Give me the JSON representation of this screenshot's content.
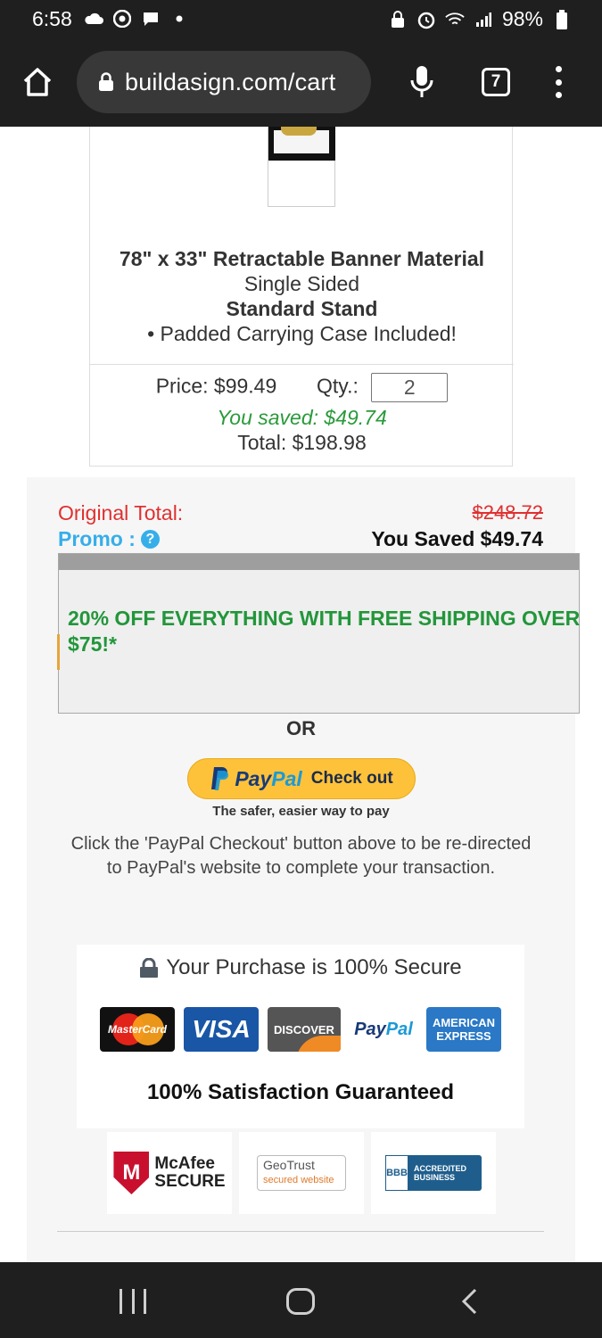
{
  "status_bar": {
    "time": "6:58",
    "battery": "98%"
  },
  "browser": {
    "url": "buildasign.com/cart",
    "tab_count": "7"
  },
  "product": {
    "title": "78\" x 33\"  Retractable Banner Material",
    "sides": "Single Sided",
    "stand": "Standard Stand",
    "extra": "• Padded Carrying Case Included!",
    "price_label": "Price: $99.49",
    "qty_label": "Qty.:",
    "qty_value": "2",
    "saved": "You saved: $49.74",
    "total": "Total: $198.98"
  },
  "summary": {
    "original_total_label": "Original Total:",
    "original_total_value": "$248.72",
    "promo_label": "Promo :",
    "promo_help": "?",
    "you_saved": "You Saved $49.74",
    "promo_message": "20% OFF EVERYTHING WITH FREE SHIPPING OVER $75!*",
    "or": "OR"
  },
  "paypal": {
    "pay": "Pay",
    "pal": "Pal",
    "checkout": "Check out",
    "tagline": "The safer, easier way to pay",
    "description": "Click the 'PayPal Checkout' button above to be re-directed to PayPal's website to complete your transaction."
  },
  "secure": {
    "title": "Your Purchase is 100% Secure",
    "cards": {
      "mastercard": "MasterCard",
      "visa": "VISA",
      "discover": "DISCOVER",
      "paypal": "PayPal",
      "amex": "AMERICAN EXPRESS"
    },
    "guarantee": "100% Satisfaction Guaranteed"
  },
  "badges": {
    "mcafee_line1": "McAfee",
    "mcafee_line2": "SECURE",
    "geotrust": "GeoTrust",
    "geotrust_sub": "secured website",
    "bbb_seal": "BBB",
    "bbb_text": "ACCREDITED BUSINESS"
  },
  "colors": {
    "original_total": "#e03030",
    "promo_label": "#36aeea",
    "promo_message": "#22963a",
    "saved_text": "#2a9a3a",
    "paypal_button": "#fec23a"
  }
}
